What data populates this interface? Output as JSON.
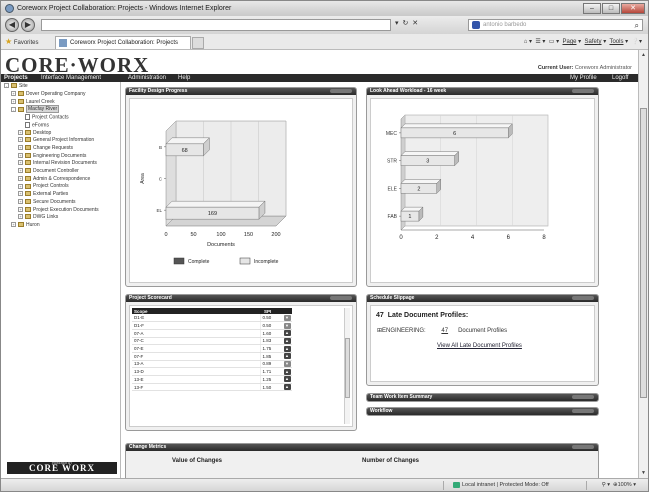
{
  "browser": {
    "title": "Coreworx Project Collaboration: Projects - Windows Internet Explorer",
    "address_placeholder": "",
    "search_text": "antonio barbedo",
    "favorites_label": "Favorites",
    "tab_label": "Coreworx Project Collaboration: Projects",
    "commands": [
      "Page",
      "Safety",
      "Tools"
    ],
    "status_zone": "Local intranet | Protected Mode: Off",
    "zoom": "100%"
  },
  "app": {
    "logo": "CORE·WORX",
    "current_user_label": "Current User:",
    "current_user": "Coreworx Administrator",
    "menu": [
      "Projects",
      "Interface Management",
      "Administration",
      "Help"
    ],
    "menu_right": [
      "My Profile",
      "Logoff"
    ],
    "footer_logo": "CORE WORX",
    "footer_small": "POWERED BY"
  },
  "tree": {
    "root": "Site",
    "nodes": [
      {
        "label": "Dover Operating Company",
        "level": 1,
        "type": "folder",
        "toggle": "+"
      },
      {
        "label": "Laurel Creek",
        "level": 1,
        "type": "folder",
        "toggle": "+"
      },
      {
        "label": "Macfay River",
        "level": 1,
        "type": "folder",
        "toggle": "-",
        "selected": true
      },
      {
        "label": "Project Contacts",
        "level": 2,
        "type": "doc",
        "toggle": ""
      },
      {
        "label": "eForms",
        "level": 2,
        "type": "doc",
        "toggle": ""
      },
      {
        "label": "Desktop",
        "level": 2,
        "type": "folder",
        "toggle": "+"
      },
      {
        "label": "General Project Information",
        "level": 2,
        "type": "folder",
        "toggle": "+"
      },
      {
        "label": "Change Requests",
        "level": 2,
        "type": "folder",
        "toggle": "+"
      },
      {
        "label": "Engineering Documents",
        "level": 2,
        "type": "folder",
        "toggle": "+"
      },
      {
        "label": "Internal Revision Documents",
        "level": 2,
        "type": "folder",
        "toggle": "+"
      },
      {
        "label": "Document Controller",
        "level": 2,
        "type": "folder",
        "toggle": "+"
      },
      {
        "label": "Admin & Correspondence",
        "level": 2,
        "type": "folder",
        "toggle": "+"
      },
      {
        "label": "Project Controls",
        "level": 2,
        "type": "folder",
        "toggle": "+"
      },
      {
        "label": "External Parties",
        "level": 2,
        "type": "folder",
        "toggle": "+"
      },
      {
        "label": "Secure Documents",
        "level": 2,
        "type": "folder",
        "toggle": "+"
      },
      {
        "label": "Project Execution Documents",
        "level": 2,
        "type": "folder",
        "toggle": "+"
      },
      {
        "label": "DWG Links",
        "level": 2,
        "type": "folder",
        "toggle": "+"
      },
      {
        "label": "Huron",
        "level": 1,
        "type": "folder",
        "toggle": "+"
      }
    ]
  },
  "panels": {
    "facility": {
      "title": "Facility Design Progress"
    },
    "lookahead": {
      "title": "Look Ahead Workload - 16 week"
    },
    "scorecard": {
      "title": "Project Scorecard",
      "headers": [
        "Scope",
        "SPI"
      ],
      "rows": [
        {
          "scope": "D1-E",
          "spi": "0.50",
          "trend": "down"
        },
        {
          "scope": "D1-F",
          "spi": "0.50",
          "trend": "down"
        },
        {
          "scope": "07-A",
          "spi": "1.60",
          "trend": "up"
        },
        {
          "scope": "07-C",
          "spi": "1.83",
          "trend": "up"
        },
        {
          "scope": "07-E",
          "spi": "1.75",
          "trend": "up"
        },
        {
          "scope": "07-F",
          "spi": "1.85",
          "trend": "up"
        },
        {
          "scope": "13-A",
          "spi": "0.89",
          "trend": "down"
        },
        {
          "scope": "13-D",
          "spi": "1.71",
          "trend": "up"
        },
        {
          "scope": "13-E",
          "spi": "1.25",
          "trend": "up"
        },
        {
          "scope": "13-F",
          "spi": "1.50",
          "trend": "up"
        }
      ]
    },
    "slippage": {
      "title": "Schedule Slippage",
      "count": "47",
      "heading": "Late Document Profiles:",
      "row_label": "ENGINEERING:",
      "row_count": "47",
      "row_suffix": "Document Profiles",
      "link": "View All Late Document Profiles"
    },
    "team": {
      "title": "Team Work Item Summary"
    },
    "workflow": {
      "title": "Workflow"
    },
    "change": {
      "title": "Change Metrics",
      "left_label": "Value of Changes",
      "right_label": "Number of Changes"
    }
  },
  "chart_data": [
    {
      "type": "bar",
      "orientation": "horizontal",
      "title": "",
      "categories": [
        "B",
        "C",
        "EL"
      ],
      "series": [
        {
          "name": "Complete",
          "values": [
            0,
            0,
            0
          ]
        },
        {
          "name": "Incomplete",
          "values": [
            68,
            0,
            169
          ]
        }
      ],
      "xlabel": "Documents",
      "ylabel": "Area",
      "xlim": [
        0,
        200
      ],
      "xticks": [
        "0",
        "50",
        "100",
        "150",
        "200"
      ],
      "legend": "bottom",
      "colors": {
        "Complete": "#555555",
        "Incomplete": "#e6e6e6"
      }
    },
    {
      "type": "bar",
      "orientation": "horizontal",
      "title": "",
      "categories": [
        "MEC",
        "STR",
        "ELE",
        "FAB"
      ],
      "values": [
        6,
        3,
        2,
        1
      ],
      "xlim": [
        0,
        8
      ],
      "xticks": [
        "0",
        "2",
        "4",
        "6",
        "8"
      ],
      "grid": true
    }
  ]
}
